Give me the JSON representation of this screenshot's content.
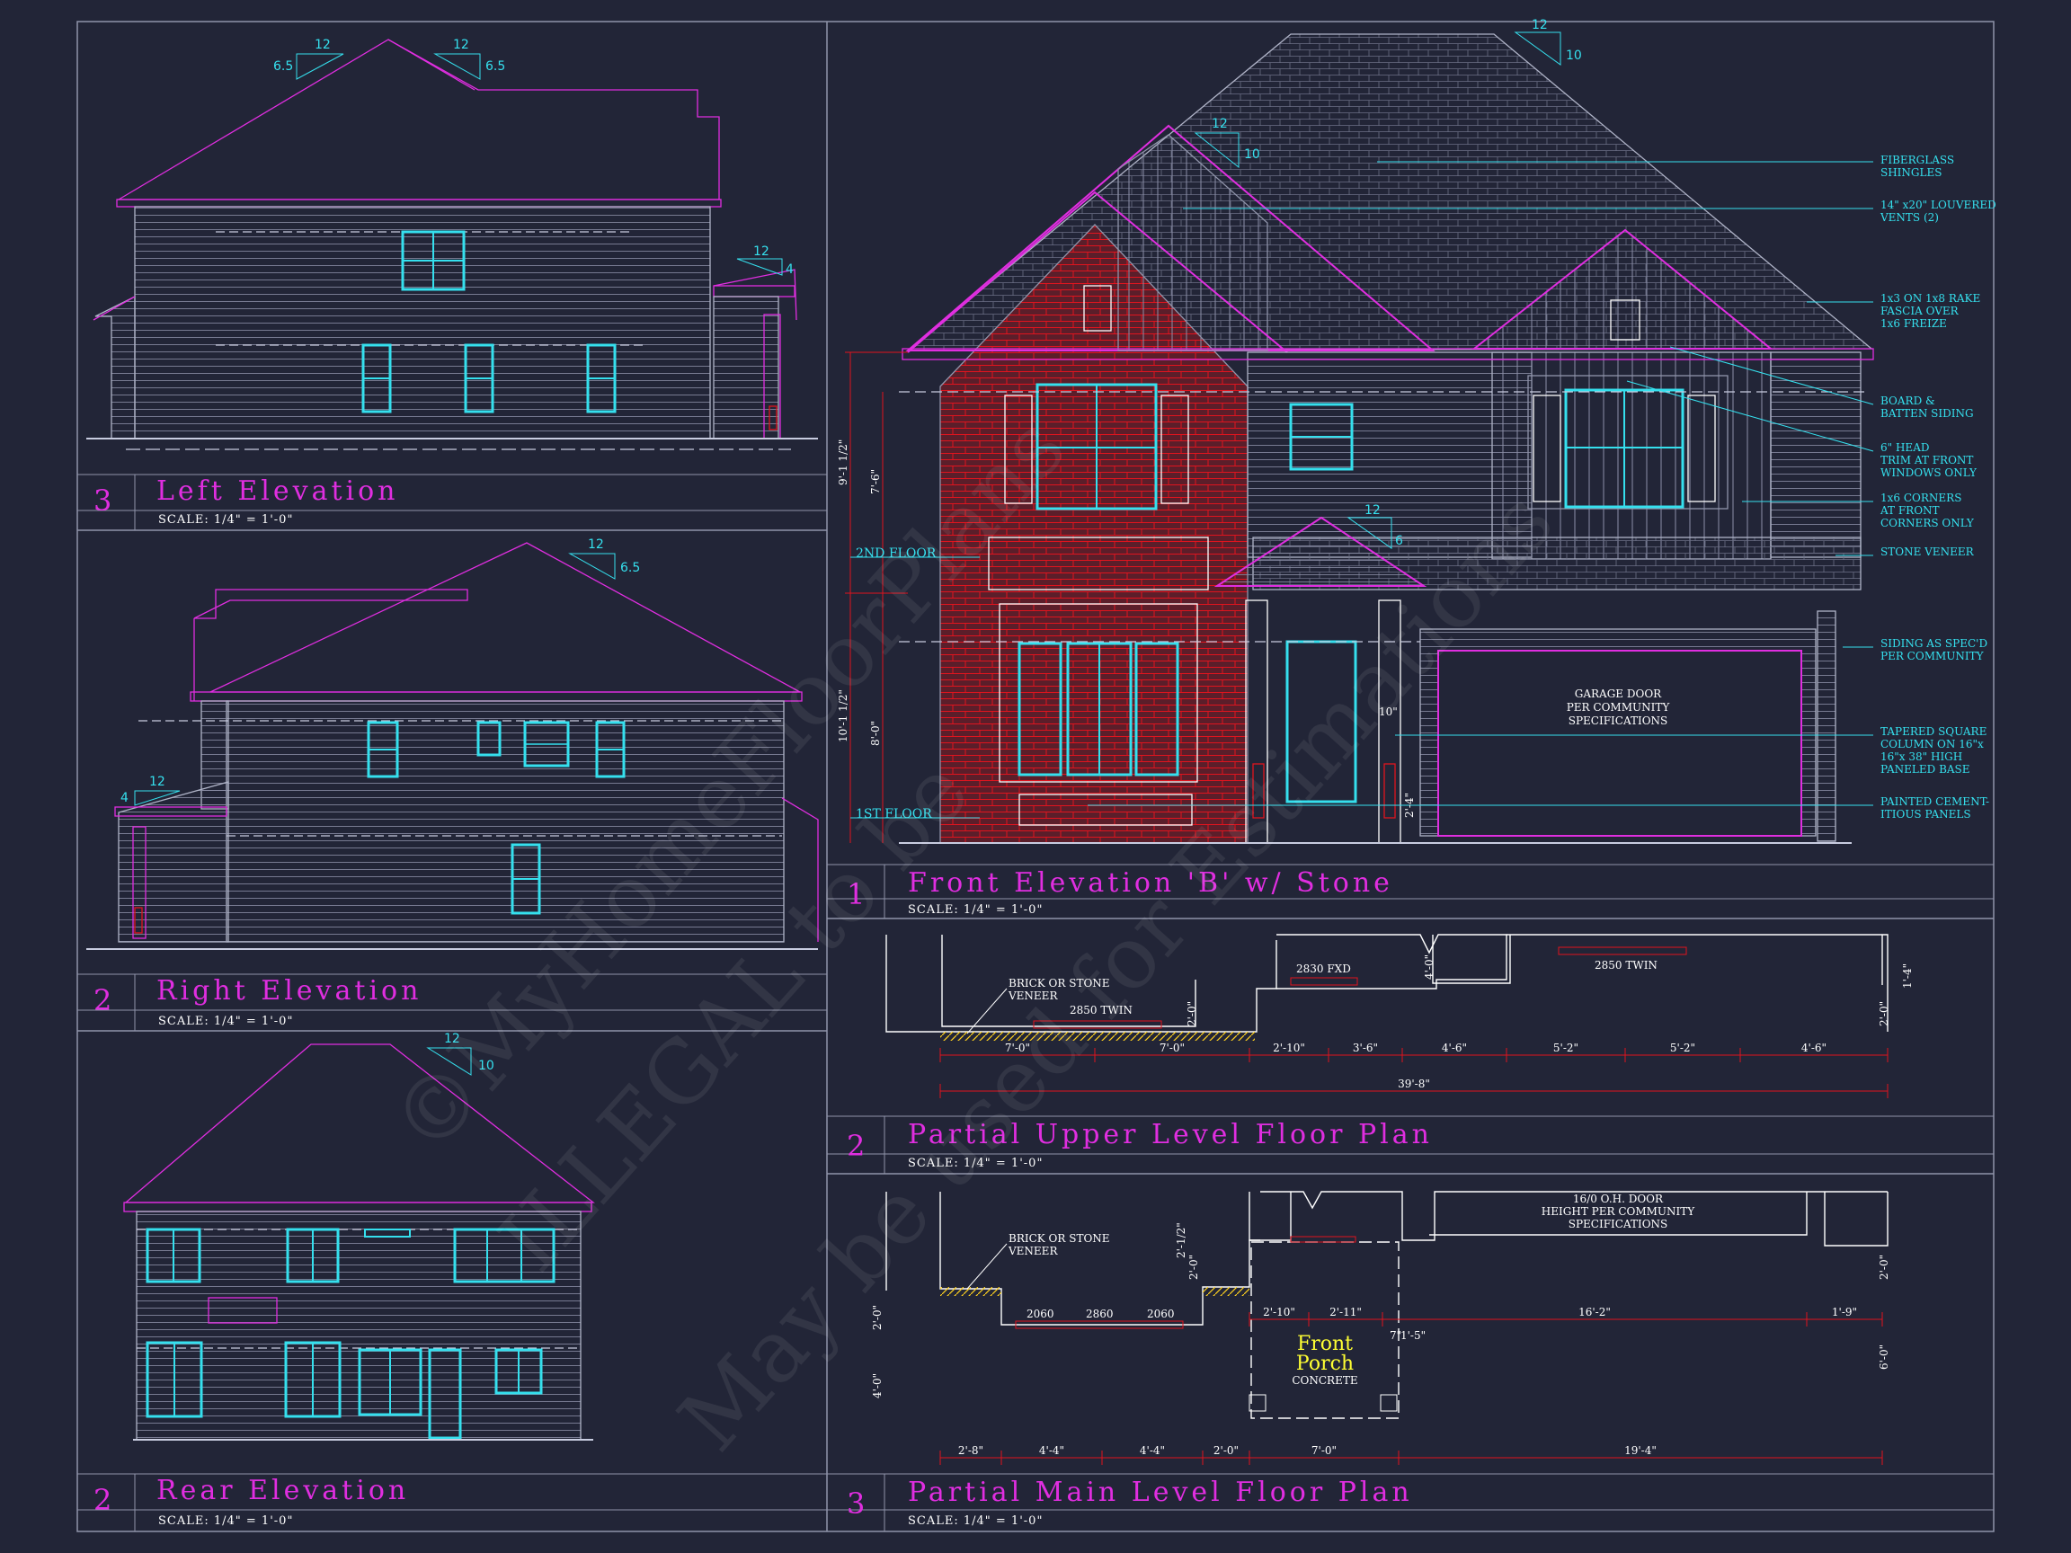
{
  "panels": {
    "left": {
      "num": "3",
      "title": "Left Elevation",
      "scale": "SCALE: 1/4\" = 1'-0\""
    },
    "right": {
      "num": "2",
      "title": "Right Elevation",
      "scale": "SCALE: 1/4\" = 1'-0\""
    },
    "rear": {
      "num": "2",
      "title": "Rear Elevation",
      "scale": "SCALE: 1/4\" = 1'-0\""
    },
    "front": {
      "num": "1",
      "title": "Front Elevation 'B' w/ Stone",
      "scale": "SCALE: 1/4\" = 1'-0\""
    },
    "upper": {
      "num": "2",
      "title": "Partial Upper Level Floor Plan",
      "scale": "SCALE: 1/4\" = 1'-0\""
    },
    "main": {
      "num": "3",
      "title": "Partial Main Level Floor Plan",
      "scale": "SCALE: 1/4\" = 1'-0\""
    }
  },
  "pitches": {
    "left_a_run": "12",
    "left_a_rise": "6.5",
    "left_b_run": "12",
    "left_b_rise": "6.5",
    "left_porch_run": "12",
    "left_porch_rise": "4",
    "right_run": "12",
    "right_rise": "6.5",
    "right_porch_run": "12",
    "right_porch_rise": "4",
    "rear_run": "12",
    "rear_rise": "10",
    "front_main_run": "12",
    "front_main_rise": "10",
    "front_gable_run": "12",
    "front_gable_rise": "10",
    "front_porch_run": "12",
    "front_porch_rise": "6"
  },
  "front": {
    "level_2nd": "2ND FLOOR",
    "level_1st": "1ST FLOOR",
    "dim_upper_total": "9'-1 1/2\"",
    "dim_upper_inner": "7'-6\"",
    "dim_lower_total": "10'-1 1/2\"",
    "dim_lower_inner": "8'-0\"",
    "dim_column": "10\"",
    "dim_step": "2'-4\"",
    "garage_note": [
      "GARAGE DOOR",
      "PER COMMUNITY",
      "SPECIFICATIONS"
    ],
    "callouts": [
      [
        "FIBERGLASS",
        "SHINGLES"
      ],
      [
        "14\" x20\" LOUVERED",
        "VENTS (2)"
      ],
      [
        "1x3 ON 1x8 RAKE",
        "FASCIA OVER",
        "1x6 FREIZE"
      ],
      [
        "BOARD &",
        "BATTEN SIDING"
      ],
      [
        "6\" HEAD",
        "TRIM AT FRONT",
        "WINDOWS ONLY"
      ],
      [
        "1x6 CORNERS",
        "AT FRONT",
        "CORNERS ONLY"
      ],
      [
        "STONE VENEER"
      ],
      [
        "SIDING AS SPEC'D",
        "PER COMMUNITY"
      ],
      [
        "TAPERED SQUARE",
        "COLUMN ON 16\"x",
        "16\"x 38\" HIGH",
        "PANELED BASE"
      ],
      [
        "PAINTED CEMENT-",
        "ITIOUS PANELS"
      ]
    ]
  },
  "upper_plan": {
    "brick_note": [
      "BRICK OR STONE",
      "VENEER"
    ],
    "win_2850_left": "2850 TWIN",
    "win_2830": "2830 FXD",
    "win_2850_right": "2850 TWIN",
    "dim_4_0": "4'-0\"",
    "dim_2_0": "2'-0\"",
    "dim_2_0_b": "2'-0\"",
    "dim_1_4": "1'-4\"",
    "dims": [
      "7'-0\"",
      "7'-0\"",
      "2'-10\"",
      "3'-6\"",
      "4'-6\"",
      "5'-2\"",
      "5'-2\"",
      "4'-6\""
    ],
    "total": "39'-8\""
  },
  "main_plan": {
    "brick_note": [
      "BRICK OR STONE",
      "VENEER"
    ],
    "door_note": [
      "16/0 O.H. DOOR",
      "HEIGHT PER COMMUNITY",
      "SPECIFICATIONS"
    ],
    "windows": [
      "2060",
      "2860",
      "2060"
    ],
    "porch_title": [
      "Front",
      "Porch"
    ],
    "porch_sub": "CONCRETE",
    "dim_2_1_2": "2'-1/2\"",
    "dim_2_0_v": "2'-0\"",
    "dim_2_0_l": "2'-0\"",
    "dim_4_0_l": "4'-0\"",
    "dim_2_0_r": "2'-0\"",
    "dim_6_0_r": "6'-0\"",
    "dim_1_5": "1'-5\"",
    "dim_7": "7\"",
    "inner_dims": [
      "2'-10\"",
      "2'-11\"",
      "16'-2\"",
      "1'-9\""
    ],
    "bottom_dims": [
      "2'-8\"",
      "4'-4\"",
      "4'-4\"",
      "2'-0\"",
      "7'-0\"",
      "19'-4\""
    ]
  },
  "watermark": [
    "©MyHomeFloorPlans",
    "ILLEGAL to be",
    "May be used for Estimations"
  ],
  "colors": {
    "background": "#222537",
    "magenta": "#e02ee0",
    "cyan": "#35e0ee",
    "red": "#e0141e",
    "brick": "#7a2430"
  }
}
